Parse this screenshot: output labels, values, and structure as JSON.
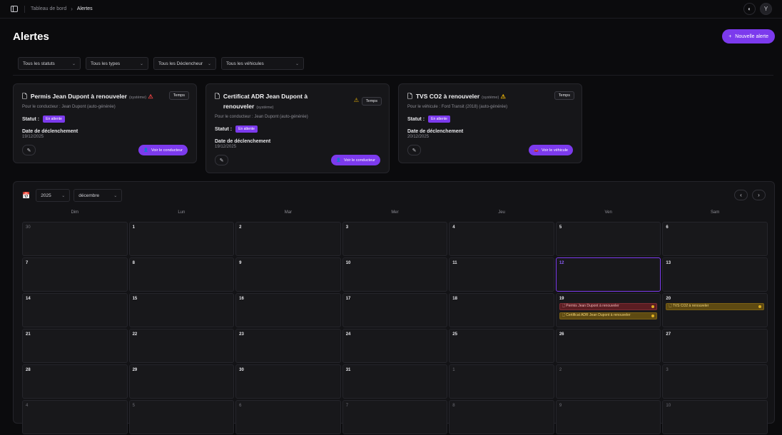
{
  "breadcrumb": {
    "parent": "Tableau de bord",
    "current": "Alertes"
  },
  "user_initial": "Y",
  "page_title": "Alertes",
  "new_alert_label": "Nouvelle alerte",
  "filters": [
    "Tous les statuts",
    "Tous les types",
    "Tous les Déclencheur",
    "Tous les véhicules"
  ],
  "cards": [
    {
      "title": "Permis Jean Dupont à renouveler",
      "system": "(système)",
      "warn": "red",
      "tag": "Temps",
      "sub": "Pour le conducteur : Jean Dupont (auto-générée)",
      "status_label": "Statut :",
      "status": "En attente",
      "date_label": "Date de déclenchement",
      "date": "19/12/2025",
      "action": "Voir le conducteur"
    },
    {
      "title": "Certificat ADR Jean Dupont à renouveler",
      "system": "(système)",
      "warn": "yellow",
      "tag": "Temps",
      "sub": "Pour le conducteur : Jean Dupont (auto-générée)",
      "status_label": "Statut :",
      "status": "En attente",
      "date_label": "Date de déclenchement",
      "date": "19/12/2025",
      "action": "Voir le conducteur"
    },
    {
      "title": "TVS CO2 à renouveler",
      "system": "(système)",
      "warn": "yellow",
      "tag": "Temps",
      "sub": "Pour le véhicule : Ford Transit (2018) (auto-générée)",
      "status_label": "Statut :",
      "status": "En attente",
      "date_label": "Date de déclenchement",
      "date": "20/12/2025",
      "action": "Voir le véhicule"
    }
  ],
  "calendar": {
    "year": "2025",
    "month": "décembre",
    "weekdays": [
      "Dim",
      "Lun",
      "Mar",
      "Mer",
      "Jeu",
      "Ven",
      "Sam"
    ],
    "days": [
      {
        "n": "30",
        "other": true
      },
      {
        "n": "1"
      },
      {
        "n": "2"
      },
      {
        "n": "3"
      },
      {
        "n": "4"
      },
      {
        "n": "5"
      },
      {
        "n": "6"
      },
      {
        "n": "7"
      },
      {
        "n": "8"
      },
      {
        "n": "9"
      },
      {
        "n": "10"
      },
      {
        "n": "11"
      },
      {
        "n": "12",
        "today": true
      },
      {
        "n": "13"
      },
      {
        "n": "14"
      },
      {
        "n": "15"
      },
      {
        "n": "16"
      },
      {
        "n": "17"
      },
      {
        "n": "18"
      },
      {
        "n": "19",
        "events": [
          {
            "label": "Permis Jean Dupont à renouveler",
            "color": "red"
          },
          {
            "label": "Certificat ADR Jean Dupont à renouveler",
            "color": "yellow"
          }
        ]
      },
      {
        "n": "20",
        "events": [
          {
            "label": "TVS CO2 à renouveler",
            "color": "yellow"
          }
        ]
      },
      {
        "n": "21"
      },
      {
        "n": "22"
      },
      {
        "n": "23"
      },
      {
        "n": "24"
      },
      {
        "n": "25"
      },
      {
        "n": "26"
      },
      {
        "n": "27"
      },
      {
        "n": "28"
      },
      {
        "n": "29"
      },
      {
        "n": "30"
      },
      {
        "n": "31"
      },
      {
        "n": "1",
        "other": true
      },
      {
        "n": "2",
        "other": true
      },
      {
        "n": "3",
        "other": true
      },
      {
        "n": "4",
        "other": true
      },
      {
        "n": "5",
        "other": true
      },
      {
        "n": "6",
        "other": true
      },
      {
        "n": "7",
        "other": true
      },
      {
        "n": "8",
        "other": true
      },
      {
        "n": "9",
        "other": true
      },
      {
        "n": "10",
        "other": true
      }
    ]
  },
  "colors": {
    "accent": "#7c3aed",
    "warn_red": "#ef4444",
    "warn_yellow": "#eab308"
  }
}
